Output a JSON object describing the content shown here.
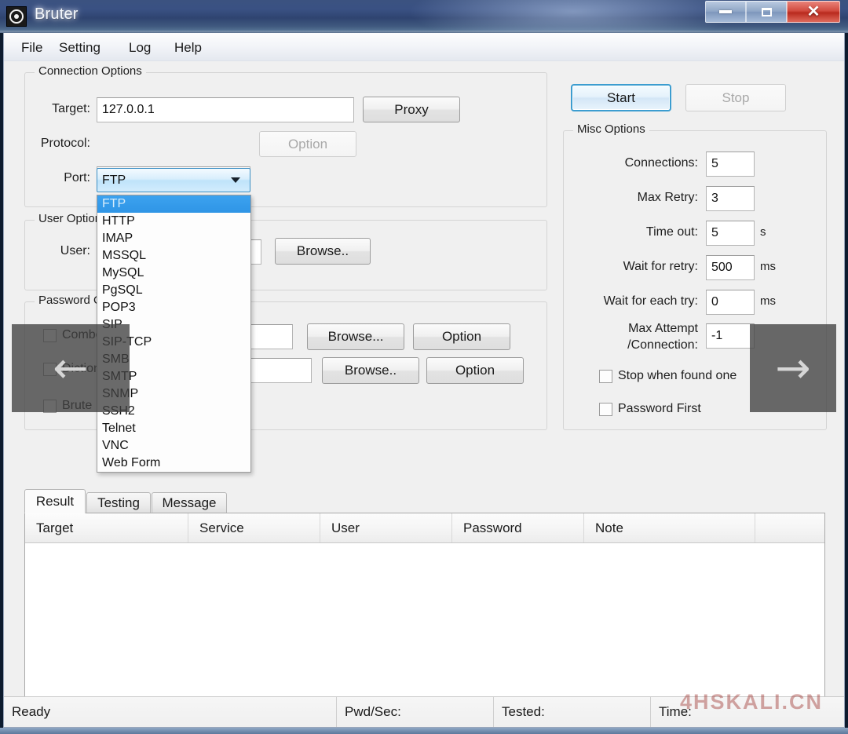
{
  "window": {
    "title": "Bruter",
    "icon": "target-icon",
    "controls": {
      "minimize": "minimize-icon",
      "maximize": "maximize-icon",
      "close": "✕"
    }
  },
  "menubar": {
    "items": [
      {
        "label": "File"
      },
      {
        "label": "Setting"
      },
      {
        "label": "Log"
      },
      {
        "label": "Help"
      }
    ]
  },
  "connection_options": {
    "title": "Connection Options",
    "target_label": "Target:",
    "target_value": "127.0.0.1",
    "proxy_button": "Proxy",
    "protocol_label": "Protocol:",
    "protocol_value": "FTP",
    "option_button": "Option",
    "port_label": "Port:",
    "port_value": "",
    "protocol_options": [
      "FTP",
      "HTTP",
      "IMAP",
      "MSSQL",
      "MySQL",
      "PgSQL",
      "POP3",
      "SIP",
      "SIP-TCP",
      "SMB",
      "SMTP",
      "SNMP",
      "SSH2",
      "Telnet",
      "VNC",
      "Web Form"
    ],
    "protocol_selected_index": 0
  },
  "user_options": {
    "title": "User Options",
    "user_label": "User:",
    "user_value": "",
    "browse_button": "Browse.."
  },
  "password_options": {
    "title": "Password Options",
    "combo_label": "Combo",
    "dictionary_label": "Dictionary",
    "brute_label": "Brute Force",
    "combo_value": "",
    "dictionary_value": "",
    "browse_button_1": "Browse...",
    "option_button_1": "Option",
    "browse_button_2": "Browse..",
    "option_button_2": "Option"
  },
  "actions": {
    "start_button": "Start",
    "stop_button": "Stop"
  },
  "misc_options": {
    "title": "Misc Options",
    "fields": [
      {
        "label": "Connections:",
        "value": "5",
        "unit": ""
      },
      {
        "label": "Max Retry:",
        "value": "3",
        "unit": ""
      },
      {
        "label": "Time out:",
        "value": "5",
        "unit": "s"
      },
      {
        "label": "Wait for retry:",
        "value": "500",
        "unit": "ms"
      },
      {
        "label": "Wait for each try:",
        "value": "0",
        "unit": "ms"
      }
    ],
    "max_attempt_label_line1": "Max Attempt",
    "max_attempt_label_line2": "/Connection:",
    "max_attempt_value": "-1",
    "stop_when_found_label": "Stop when found one",
    "password_first_label": "Password First"
  },
  "tabs": [
    {
      "label": "Result",
      "active": true
    },
    {
      "label": "Testing",
      "active": false
    },
    {
      "label": "Message",
      "active": false
    }
  ],
  "result_table": {
    "columns": [
      "Target",
      "Service",
      "User",
      "Password",
      "Note"
    ],
    "rows": []
  },
  "statusbar": {
    "cells": [
      "Ready",
      "Pwd/Sec:",
      "Tested:",
      "Time:"
    ]
  },
  "overlays": {
    "left_arrow": "←",
    "right_arrow": "→"
  },
  "watermark": "4HSKALI.CN",
  "colors": {
    "titlebar_blue": "#3a5183",
    "close_red": "#b92a1e",
    "accent_blue": "#3c9dd0",
    "selection_blue": "#2f95e6"
  }
}
